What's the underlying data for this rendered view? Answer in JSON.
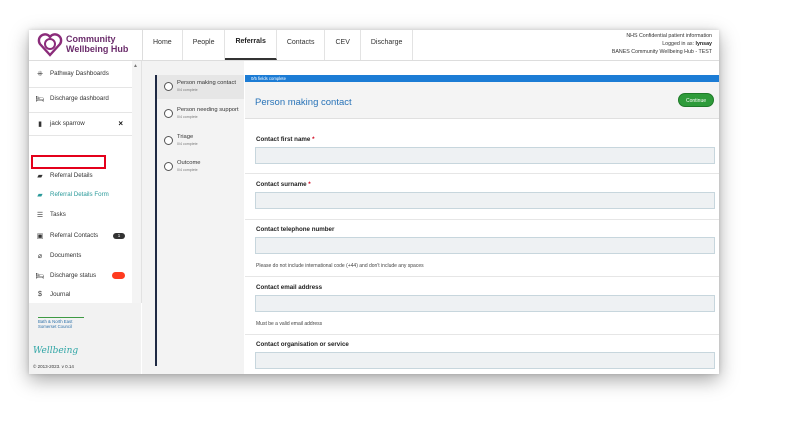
{
  "app": {
    "logo_line1": "Community",
    "logo_line2": "Wellbeing Hub",
    "brand_color": "#6b2c6b"
  },
  "nav": {
    "items": [
      "Home",
      "People",
      "Referrals",
      "Contacts",
      "CEV",
      "Discharge"
    ],
    "active": "Referrals"
  },
  "user_info": {
    "line1": "NHS Confidential patient information",
    "line2_prefix": "Logged in as:",
    "line2_user": "lynsay",
    "line3": "BANES Community Wellbeing Hub - TEST"
  },
  "sidebar": {
    "items": [
      {
        "label": "Pathway Dashboards",
        "icon": "dashboard-icon"
      },
      {
        "label": "Discharge dashboard",
        "icon": "bed-icon"
      },
      {
        "label": "jack sparrow",
        "icon": "document-icon"
      },
      {
        "label": "Referral Details",
        "icon": "folder-icon"
      },
      {
        "label": "Referral Details Form",
        "icon": "folder-open-icon"
      },
      {
        "label": "Tasks",
        "icon": "list-icon"
      },
      {
        "label": "Referral Contacts",
        "icon": "contact-card-icon",
        "badge": "1"
      },
      {
        "label": "Documents",
        "icon": "paperclip-icon"
      },
      {
        "label": "Discharge status",
        "icon": "bed-icon"
      },
      {
        "label": "Journal",
        "icon": "journal-icon"
      }
    ],
    "discharge_status_color": "#ff3b1f",
    "council_line1": "Bath & North East",
    "council_line2": "Somerset Council",
    "wellbeing_logo": "Wellbeing",
    "copyright": "© 2013-2023. v 0.14"
  },
  "steps": [
    {
      "title": "Person making contact",
      "sub": "0/4 complete"
    },
    {
      "title": "Person needing support",
      "sub": "0/4 complete"
    },
    {
      "title": "Triage",
      "sub": "0/4 complete"
    },
    {
      "title": "Outcome",
      "sub": "0/4 complete"
    }
  ],
  "form": {
    "progress_text": "0/5 fields complete",
    "title": "Person making contact",
    "continue_label": "Continue",
    "fields": [
      {
        "label": "Contact first name",
        "required": true,
        "value": "",
        "hint": ""
      },
      {
        "label": "Contact surname",
        "required": true,
        "value": "",
        "hint": ""
      },
      {
        "label": "Contact telephone number",
        "required": false,
        "value": "",
        "hint": "Please do not include international code (+44) and don't include any spaces"
      },
      {
        "label": "Contact email address",
        "required": false,
        "value": "",
        "hint": "Must be a valid email address"
      },
      {
        "label": "Contact organisation or service",
        "required": false,
        "value": "",
        "hint": ""
      }
    ]
  }
}
